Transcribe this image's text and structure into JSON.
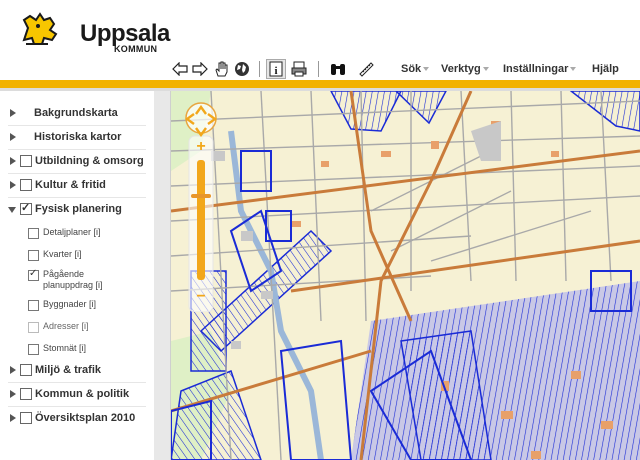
{
  "brand": {
    "name": "Uppsala",
    "subtitle": "KOMMUN"
  },
  "toolbar": {
    "icons": [
      "arrow-left-icon",
      "arrow-right-icon",
      "pan-hand-icon",
      "globe-icon",
      "info-icon",
      "print-icon",
      "binoculars-icon",
      "measure-ruler-icon"
    ],
    "menus": [
      {
        "label": "Sök",
        "has_caret": true
      },
      {
        "label": "Verktyg",
        "has_caret": true
      },
      {
        "label": "Inställningar",
        "has_caret": true
      },
      {
        "label": "Hjälp",
        "has_caret": false
      }
    ]
  },
  "sidebar": {
    "layers": [
      {
        "label": "Bakgrundskarta",
        "checkbox": false,
        "expanded": false,
        "checked": false
      },
      {
        "label": "Historiska kartor",
        "checkbox": false,
        "expanded": false,
        "checked": false
      },
      {
        "label": "Utbildning & omsorg",
        "checkbox": true,
        "expanded": false,
        "checked": false
      },
      {
        "label": "Kultur & fritid",
        "checkbox": true,
        "expanded": false,
        "checked": false
      },
      {
        "label": "Fysisk planering",
        "checkbox": true,
        "expanded": true,
        "checked": true
      },
      {
        "label": "Miljö & trafik",
        "checkbox": true,
        "expanded": false,
        "checked": false
      },
      {
        "label": "Kommun & politik",
        "checkbox": true,
        "expanded": false,
        "checked": false
      },
      {
        "label": "Översiktsplan 2010",
        "checkbox": true,
        "expanded": false,
        "checked": false
      }
    ],
    "sublayers": [
      {
        "label": "Detaljplaner [i]",
        "checked": false,
        "disabled": false
      },
      {
        "label": "Kvarter [i]",
        "checked": false,
        "disabled": false
      },
      {
        "label_line1": "Pågående",
        "label_line2": "planuppdrag [i]",
        "checked": true,
        "disabled": false
      },
      {
        "label": "Byggnader [i]",
        "checked": false,
        "disabled": false
      },
      {
        "label": "Adresser [i]",
        "checked": false,
        "disabled": true
      },
      {
        "label": "Stomnät [i]",
        "checked": false,
        "disabled": false
      }
    ]
  },
  "zoom": {
    "plus": "+",
    "minus": "−",
    "level": 0.72
  },
  "colors": {
    "accent": "#f2b200",
    "map_background": "#f6f1d4",
    "plan_hatch": "#1a2bd6",
    "road_major": "#c97b3a",
    "road_minor": "#a9a9a9",
    "river": "#9bb7d8"
  }
}
